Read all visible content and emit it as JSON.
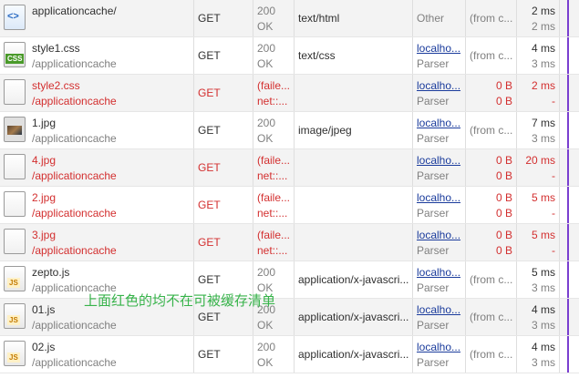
{
  "rows": [
    {
      "icon": "html-document-icon",
      "name": "applicationcache/",
      "path": "",
      "method": "GET",
      "status1": "200",
      "status2": "OK",
      "type": "text/html",
      "init1": "Other",
      "init2": "",
      "size1": "(from c...",
      "size2": "",
      "time1": "2 ms",
      "time2": "2 ms",
      "error": false
    },
    {
      "icon": "css-file-icon",
      "name": "style1.css",
      "path": "/applicationcache",
      "method": "GET",
      "status1": "200",
      "status2": "OK",
      "type": "text/css",
      "init1": "localho...",
      "init2": "Parser",
      "size1": "(from c...",
      "size2": "",
      "time1": "4 ms",
      "time2": "3 ms",
      "error": false
    },
    {
      "icon": "blank-file-icon",
      "name": "style2.css",
      "path": "/applicationcache",
      "method": "GET",
      "status1": "(faile...",
      "status2": "net::...",
      "type": "",
      "init1": "localho...",
      "init2": "Parser",
      "size1": "0 B",
      "size2": "0 B",
      "time1": "2 ms",
      "time2": "-",
      "error": true
    },
    {
      "icon": "image-file-icon",
      "name": "1.jpg",
      "path": "/applicationcache",
      "method": "GET",
      "status1": "200",
      "status2": "OK",
      "type": "image/jpeg",
      "init1": "localho...",
      "init2": "Parser",
      "size1": "(from c...",
      "size2": "",
      "time1": "7 ms",
      "time2": "3 ms",
      "error": false
    },
    {
      "icon": "blank-file-icon",
      "name": "4.jpg",
      "path": "/applicationcache",
      "method": "GET",
      "status1": "(faile...",
      "status2": "net::...",
      "type": "",
      "init1": "localho...",
      "init2": "Parser",
      "size1": "0 B",
      "size2": "0 B",
      "time1": "20 ms",
      "time2": "-",
      "error": true
    },
    {
      "icon": "blank-file-icon",
      "name": "2.jpg",
      "path": "/applicationcache",
      "method": "GET",
      "status1": "(faile...",
      "status2": "net::...",
      "type": "",
      "init1": "localho...",
      "init2": "Parser",
      "size1": "0 B",
      "size2": "0 B",
      "time1": "5 ms",
      "time2": "-",
      "error": true
    },
    {
      "icon": "blank-file-icon",
      "name": "3.jpg",
      "path": "/applicationcache",
      "method": "GET",
      "status1": "(faile...",
      "status2": "net::...",
      "type": "",
      "init1": "localho...",
      "init2": "Parser",
      "size1": "0 B",
      "size2": "0 B",
      "time1": "5 ms",
      "time2": "-",
      "error": true
    },
    {
      "icon": "js-file-icon",
      "name": "zepto.js",
      "path": "/applicationcache",
      "method": "GET",
      "status1": "200",
      "status2": "OK",
      "type": "application/x-javascri...",
      "init1": "localho...",
      "init2": "Parser",
      "size1": "(from c...",
      "size2": "",
      "time1": "5 ms",
      "time2": "3 ms",
      "error": false
    },
    {
      "icon": "js-file-icon",
      "name": "01.js",
      "path": "/applicationcache",
      "method": "GET",
      "status1": "200",
      "status2": "OK",
      "type": "application/x-javascri...",
      "init1": "localho...",
      "init2": "Parser",
      "size1": "(from c...",
      "size2": "",
      "time1": "4 ms",
      "time2": "3 ms",
      "error": false
    },
    {
      "icon": "js-file-icon",
      "name": "02.js",
      "path": "/applicationcache",
      "method": "GET",
      "status1": "200",
      "status2": "OK",
      "type": "application/x-javascri...",
      "init1": "localho...",
      "init2": "Parser",
      "size1": "(from c...",
      "size2": "",
      "time1": "4 ms",
      "time2": "3 ms",
      "error": false
    }
  ],
  "annotation": "上面红色的均不在可被缓存清单",
  "colors": {
    "error": "#d32f2f",
    "link": "#1a3b9c",
    "annotation": "#37b34a",
    "timeline": "#7a3fd0"
  }
}
